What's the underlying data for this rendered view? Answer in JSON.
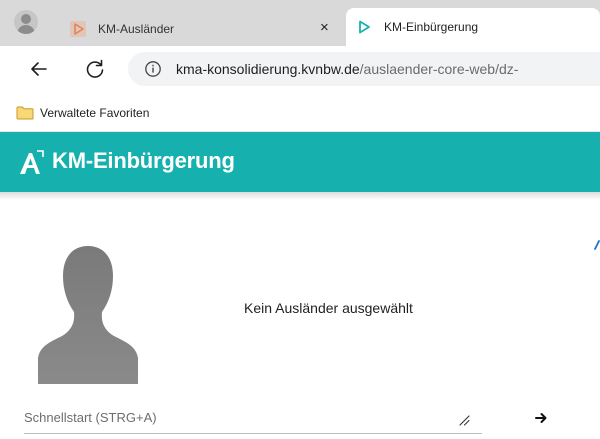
{
  "tabs": [
    {
      "title": "KM-Ausländer",
      "close": "×"
    },
    {
      "title": "KM-Einbürgerung",
      "close": "×"
    }
  ],
  "address": {
    "host": "kma-konsolidierung.kvnbw.de",
    "path": "/auslaender-core-web/dz-"
  },
  "favorites": {
    "folder_label": "Verwaltete Favoriten"
  },
  "app": {
    "title": "KM-Einbürgerung",
    "accent_color": "#16b1ae"
  },
  "content": {
    "status_text": "Kein Ausländer ausgewählt"
  },
  "quickstart": {
    "placeholder": "Schnellstart (STRG+A)"
  },
  "icons": {
    "profile": "profile-avatar-icon",
    "tab_app": "play-triangle-icon",
    "back": "back-arrow-icon",
    "reload": "reload-icon",
    "site_info": "info-icon",
    "folder": "folder-icon",
    "logo": "app-logo-icon",
    "placeholder_person": "person-silhouette-icon",
    "resize": "resize-handle-icon",
    "go": "arrow-right-icon"
  }
}
